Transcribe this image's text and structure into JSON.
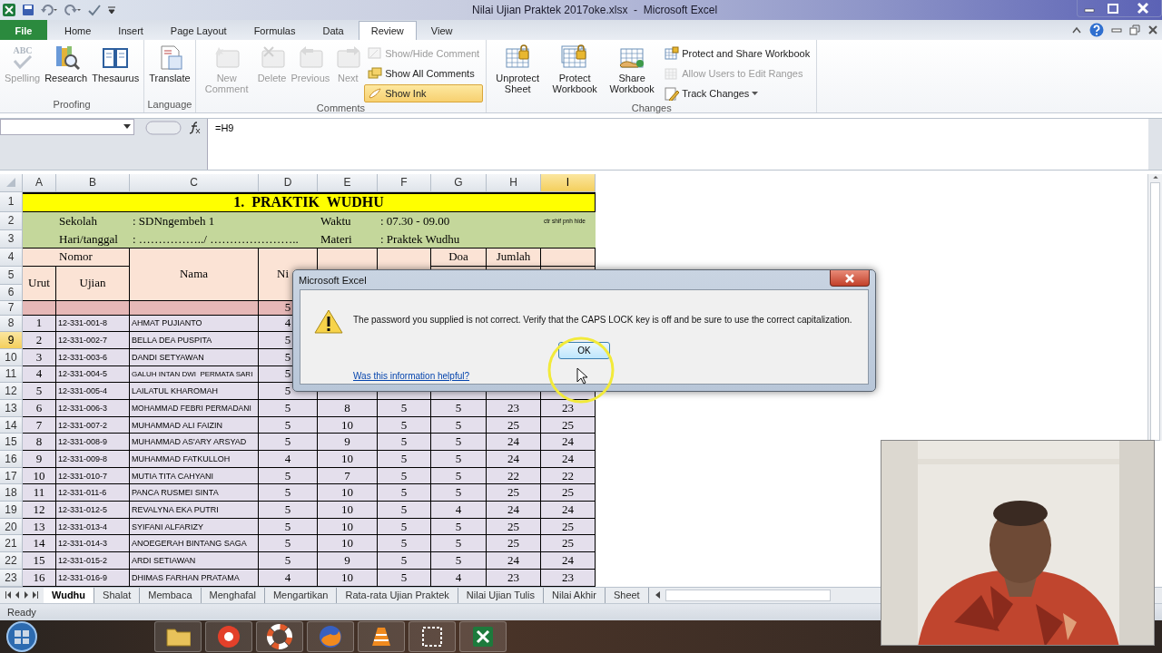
{
  "window": {
    "title": "Nilai Ujian Praktek 2017oke.xlsx  -  Microsoft Excel"
  },
  "tabs": [
    {
      "label": "File",
      "selected": false
    },
    {
      "label": "Home",
      "selected": false
    },
    {
      "label": "Insert",
      "selected": false
    },
    {
      "label": "Page Layout",
      "selected": false
    },
    {
      "label": "Formulas",
      "selected": false
    },
    {
      "label": "Data",
      "selected": false
    },
    {
      "label": "Review",
      "selected": true
    },
    {
      "label": "View",
      "selected": false
    }
  ],
  "ribbon": {
    "groups": [
      {
        "label": "Proofing",
        "buttons": [
          {
            "kind": "large",
            "label": "Spelling",
            "icon_text": "ABC",
            "disabled": true
          },
          {
            "kind": "large",
            "label": "Research",
            "disabled": false
          },
          {
            "kind": "large",
            "label": "Thesaurus",
            "disabled": false
          }
        ]
      },
      {
        "label": "Language",
        "buttons": [
          {
            "kind": "large",
            "label": "Translate",
            "disabled": false
          }
        ]
      },
      {
        "label": "Comments",
        "buttons": [
          {
            "kind": "large",
            "label": "New Comment",
            "disabled": true
          },
          {
            "kind": "large",
            "label": "Delete",
            "disabled": true
          },
          {
            "kind": "large",
            "label": "Previous",
            "disabled": true
          },
          {
            "kind": "large",
            "label": "Next",
            "disabled": true
          },
          {
            "kind": "small",
            "label": "Show/Hide Comment",
            "disabled": true,
            "selected": false
          },
          {
            "kind": "small",
            "label": "Show All Comments",
            "disabled": false,
            "selected": false
          },
          {
            "kind": "small",
            "label": "Show Ink",
            "disabled": false,
            "selected": true
          }
        ]
      },
      {
        "label": "Changes",
        "buttons": [
          {
            "kind": "large",
            "label": "Unprotect Sheet",
            "disabled": false
          },
          {
            "kind": "large",
            "label": "Protect Workbook",
            "disabled": false
          },
          {
            "kind": "large",
            "label": "Share Workbook",
            "disabled": false
          },
          {
            "kind": "small",
            "label": "Protect and Share Workbook",
            "disabled": false
          },
          {
            "kind": "small",
            "label": "Allow Users to Edit Ranges",
            "disabled": true
          },
          {
            "kind": "dropdown",
            "label": "Track Changes",
            "disabled": false
          }
        ]
      }
    ]
  },
  "formula_bar": {
    "formula": "=H9"
  },
  "sheet": {
    "columns": [
      {
        "label": "A",
        "selected": false
      },
      {
        "label": "B",
        "selected": false
      },
      {
        "label": "C",
        "selected": false
      },
      {
        "label": "D",
        "selected": false
      },
      {
        "label": "E",
        "selected": false
      },
      {
        "label": "F",
        "selected": false
      },
      {
        "label": "G",
        "selected": false
      },
      {
        "label": "H",
        "selected": false
      },
      {
        "label": "I",
        "selected": true
      }
    ],
    "rows": [
      {
        "label": "1",
        "selected": false
      },
      {
        "label": "2",
        "selected": false
      },
      {
        "label": "3",
        "selected": false
      },
      {
        "label": "4",
        "selected": false
      },
      {
        "label": "5",
        "selected": false
      },
      {
        "label": "6",
        "selected": false
      },
      {
        "label": "7",
        "selected": false
      },
      {
        "label": "8",
        "selected": false
      },
      {
        "label": "9",
        "selected": true
      },
      {
        "label": "10",
        "selected": false
      },
      {
        "label": "11",
        "selected": false
      },
      {
        "label": "12",
        "selected": false
      },
      {
        "label": "13",
        "selected": false
      },
      {
        "label": "14",
        "selected": false
      },
      {
        "label": "15",
        "selected": false
      },
      {
        "label": "16",
        "selected": false
      },
      {
        "label": "17",
        "selected": false
      },
      {
        "label": "18",
        "selected": false
      },
      {
        "label": "19",
        "selected": false
      },
      {
        "label": "20",
        "selected": false
      },
      {
        "label": "21",
        "selected": false
      },
      {
        "label": "22",
        "selected": false
      },
      {
        "label": "23",
        "selected": false
      }
    ],
    "title": "1.  PRAKTIK  WUDHU",
    "info": [
      {
        "label": "Sekolah",
        "value": ": SDNngembeh 1",
        "label2": "Waktu",
        "value2": ": 07.30 - 09.00",
        "note": "ctr shif pnh hide"
      },
      {
        "label": "Hari/tanggal",
        "value": ": ……………../ …………………..",
        "label2": "Materi",
        "value2": ": Praktek Wudhu"
      }
    ],
    "headers": {
      "nomor": "Nomor",
      "urut": "Urut",
      "ujian": "Ujian",
      "nama": "Nama",
      "col_d": "Ni",
      "col_g": "Doa",
      "col_h": "Jumlah"
    },
    "row_7": {
      "col_d": "5"
    },
    "students": [
      {
        "urut": "1",
        "nomor": "12-331-001-8",
        "nama": "AHMAT PUJIANTO",
        "scores": [
          "4"
        ]
      },
      {
        "urut": "2",
        "nomor": "12-331-002-7",
        "nama": "BELLA DEA PUSPITA",
        "scores": [
          "5"
        ]
      },
      {
        "urut": "3",
        "nomor": "12-331-003-6",
        "nama": "DANDI SETYAWAN",
        "scores": [
          "5"
        ]
      },
      {
        "urut": "4",
        "nomor": "12-331-004-5",
        "nama": "GALUH INTAN DWI  PERMATA SARI",
        "scores": [
          "5"
        ]
      },
      {
        "urut": "5",
        "nomor": "12-331-005-4",
        "nama": "LAILATUL KHAROMAH",
        "scores": [
          "5"
        ]
      },
      {
        "urut": "6",
        "nomor": "12-331-006-3",
        "nama": "MOHAMMAD FEBRI PERMADANI",
        "scores": [
          "5",
          "8",
          "5",
          "5",
          "23",
          "23"
        ]
      },
      {
        "urut": "7",
        "nomor": "12-331-007-2",
        "nama": "MUHAMMAD ALI FAIZIN",
        "scores": [
          "5",
          "10",
          "5",
          "5",
          "25",
          "25"
        ]
      },
      {
        "urut": "8",
        "nomor": "12-331-008-9",
        "nama": "MUHAMMAD AS'ARY ARSYAD",
        "scores": [
          "5",
          "9",
          "5",
          "5",
          "24",
          "24"
        ]
      },
      {
        "urut": "9",
        "nomor": "12-331-009-8",
        "nama": "MUHAMMAD FATKULLOH",
        "scores": [
          "4",
          "10",
          "5",
          "5",
          "24",
          "24"
        ]
      },
      {
        "urut": "10",
        "nomor": "12-331-010-7",
        "nama": "MUTIA TITA CAHYANI",
        "scores": [
          "5",
          "7",
          "5",
          "5",
          "22",
          "22"
        ]
      },
      {
        "urut": "11",
        "nomor": "12-331-011-6",
        "nama": "PANCA RUSMEI SINTA",
        "scores": [
          "5",
          "10",
          "5",
          "5",
          "25",
          "25"
        ]
      },
      {
        "urut": "12",
        "nomor": "12-331-012-5",
        "nama": "REVALYNA EKA PUTRI",
        "scores": [
          "5",
          "10",
          "5",
          "4",
          "24",
          "24"
        ]
      },
      {
        "urut": "13",
        "nomor": "12-331-013-4",
        "nama": "SYIFANI ALFARIZY",
        "scores": [
          "5",
          "10",
          "5",
          "5",
          "25",
          "25"
        ]
      },
      {
        "urut": "14",
        "nomor": "12-331-014-3",
        "nama": "ANOEGERAH BINTANG SAGA",
        "scores": [
          "5",
          "10",
          "5",
          "5",
          "25",
          "25"
        ]
      },
      {
        "urut": "15",
        "nomor": "12-331-015-2",
        "nama": "ARDI SETIAWAN",
        "scores": [
          "5",
          "9",
          "5",
          "5",
          "24",
          "24"
        ]
      },
      {
        "urut": "16",
        "nomor": "12-331-016-9",
        "nama": "DHIMAS FARHAN PRATAMA",
        "scores": [
          "4",
          "10",
          "5",
          "4",
          "23",
          "23"
        ]
      }
    ]
  },
  "sheet_tabs": [
    {
      "label": "Wudhu",
      "selected": true
    },
    {
      "label": "Shalat",
      "selected": false
    },
    {
      "label": "Membaca",
      "selected": false
    },
    {
      "label": "Menghafal",
      "selected": false
    },
    {
      "label": "Mengartikan",
      "selected": false
    },
    {
      "label": "Rata-rata Ujian Praktek",
      "selected": false
    },
    {
      "label": "Nilai Ujian Tulis",
      "selected": false
    },
    {
      "label": "Nilai Akhir",
      "selected": false
    },
    {
      "label": "Sheet",
      "selected": false
    }
  ],
  "status_bar": {
    "text": "Ready"
  },
  "dialog": {
    "title": "Microsoft Excel",
    "message": "The password you supplied is not correct. Verify that the CAPS LOCK key is off and be sure to use the correct capitalization.",
    "button": "OK",
    "link": "Was this information helpful?"
  }
}
